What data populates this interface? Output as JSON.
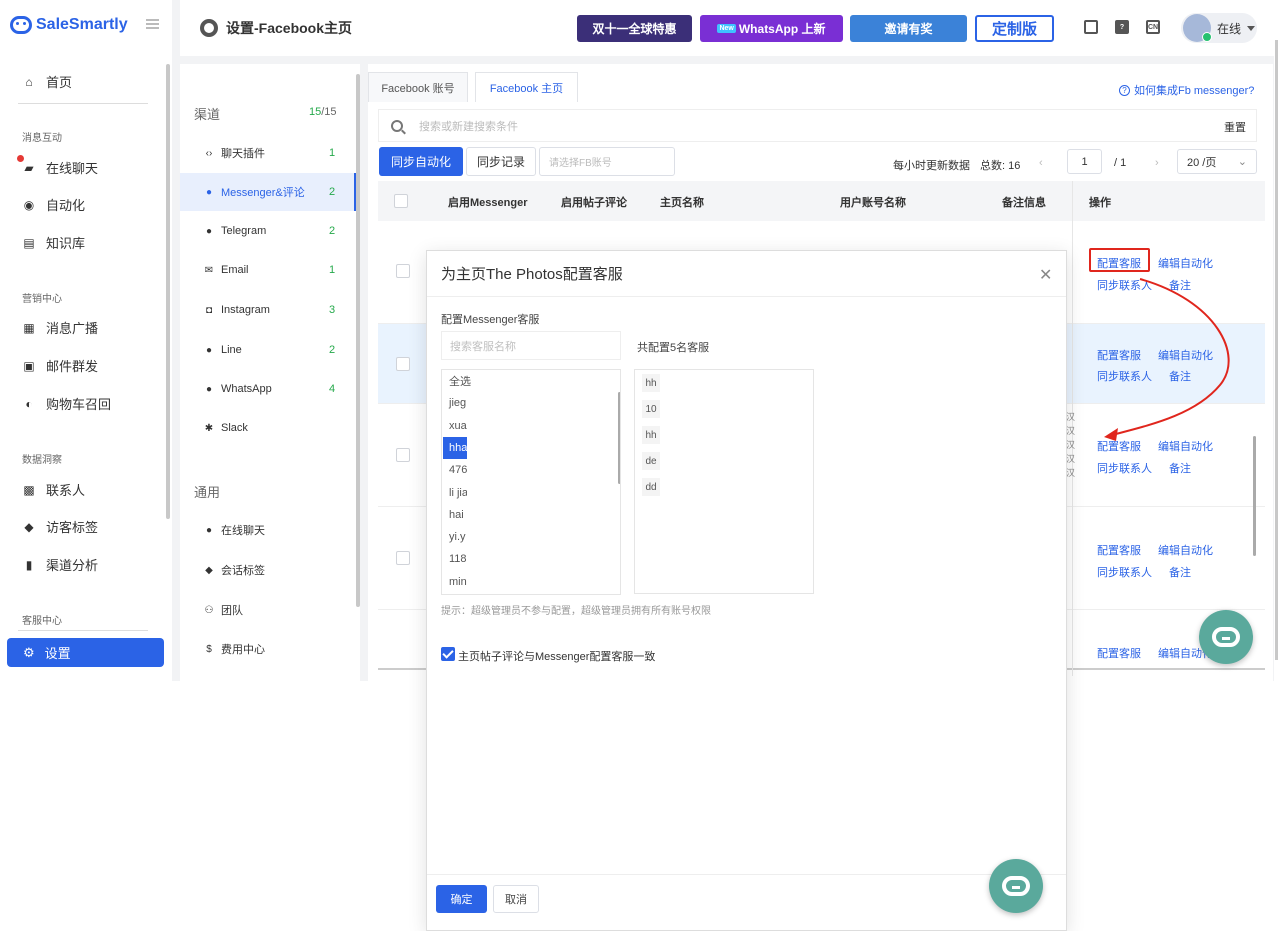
{
  "app": {
    "brand": "SaleSmartly"
  },
  "nav": {
    "home": "首页",
    "section_msg": "消息互动",
    "live_chat": "在线聊天",
    "automation": "自动化",
    "knowledge": "知识库",
    "section_marketing": "营销中心",
    "broadcast": "消息广播",
    "email_bulk": "邮件群发",
    "cart_recall": "购物车召回",
    "section_data": "数据洞察",
    "contacts": "联系人",
    "visitor_tags": "访客标签",
    "channel_analysis": "渠道分析",
    "section_service": "客服中心",
    "settings": "设置"
  },
  "header": {
    "title": "设置-Facebook主页",
    "promo1": "双十一全球特惠",
    "promo2_tag": "New",
    "promo2": "WhatsApp 上新",
    "promo3": "邀请有奖",
    "promo4": "定制版",
    "icon_cn": "CN",
    "status": "在线"
  },
  "channels": {
    "heading": "渠道",
    "count_active": "15",
    "count_total": "/15",
    "items": [
      {
        "label": "聊天插件",
        "count": "1",
        "icon": "code-icon"
      },
      {
        "label": "Messenger&评论",
        "count": "2",
        "icon": "messenger-icon"
      },
      {
        "label": "Telegram",
        "count": "2",
        "icon": "telegram-icon"
      },
      {
        "label": "Email",
        "count": "1",
        "icon": "mail-icon"
      },
      {
        "label": "Instagram",
        "count": "3",
        "icon": "instagram-icon"
      },
      {
        "label": "Line",
        "count": "2",
        "icon": "line-icon"
      },
      {
        "label": "WhatsApp",
        "count": "4",
        "icon": "whatsapp-icon"
      },
      {
        "label": "Slack",
        "count": "",
        "icon": "slack-icon"
      }
    ],
    "general_heading": "通用",
    "general": [
      {
        "label": "在线聊天",
        "icon": "chat-icon"
      },
      {
        "label": "会话标签",
        "icon": "tag-icon"
      },
      {
        "label": "团队",
        "icon": "team-icon"
      },
      {
        "label": "费用中心",
        "icon": "dollar-icon"
      }
    ]
  },
  "main": {
    "tabs": [
      "Facebook 账号",
      "Facebook 主页"
    ],
    "active_tab": 1,
    "help_link": "如何集成Fb messenger?",
    "search_placeholder": "搜索或新建搜索条件",
    "reset": "重置",
    "sync_auto": "同步自动化",
    "sync_log": "同步记录",
    "fb_select_placeholder": "请选择FB账号",
    "update_note": "每小时更新数据",
    "total": "总数: 16",
    "page_current": "1",
    "page_total": "/ 1",
    "page_size": "20 /页",
    "columns": [
      "启用Messenger",
      "启用帖子评论",
      "主页名称",
      "用户账号名称",
      "备注信息",
      "操作"
    ],
    "actions": {
      "config": "配置客服",
      "edit_auto": "编辑自动化",
      "sync_contacts": "同步联系人",
      "note": "备注"
    }
  },
  "modal": {
    "title": "为主页The Photos配置客服",
    "section_label": "配置Messenger客服",
    "search_placeholder": "搜索客服名称",
    "configured_count": "共配置5名客服",
    "left_list": [
      "全选",
      "jieg",
      "xua",
      "hha",
      "476",
      "li jia",
      "hai",
      "yi.y",
      "118",
      "min"
    ],
    "selected_index": 3,
    "right_list": [
      "hh",
      "10",
      "hh",
      "de",
      "dd"
    ],
    "tip": "提示：超级管理员不参与配置，超级管理员拥有所有账号权限",
    "checkbox_label": "主页帖子评论与Messenger配置客服一致",
    "ok": "确定",
    "cancel": "取消"
  },
  "colors": {
    "primary": "#2b63e6",
    "highlight": "#e0261d",
    "success": "#25a94b",
    "fab": "#5aa99c"
  }
}
